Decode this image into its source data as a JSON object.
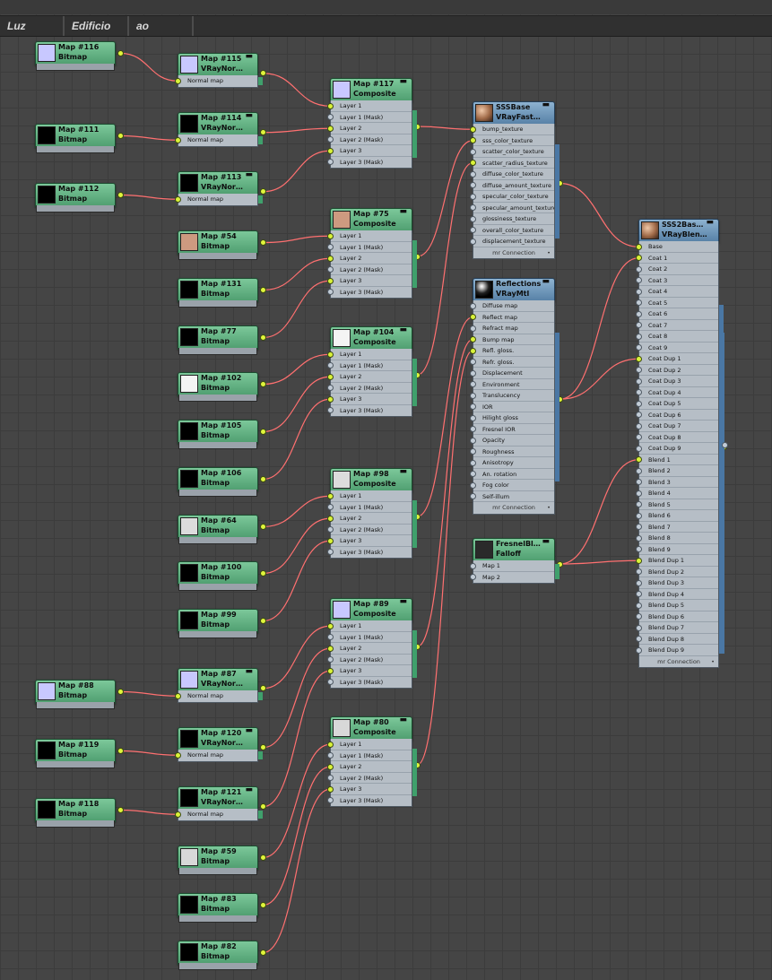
{
  "tabs": [
    {
      "label": "Luz"
    },
    {
      "label": "Edificio"
    },
    {
      "label": "ao"
    }
  ],
  "colors": {
    "wire": "#ff7070",
    "socket_on": "#d9f23a",
    "node_green": "#5ea57c",
    "node_blue": "#6d94b9"
  },
  "nodes": [
    {
      "id": "n116",
      "title": "Map #116",
      "type": "Bitmap",
      "thumb": "#c8c8ff"
    },
    {
      "id": "n111",
      "title": "Map #111",
      "type": "Bitmap",
      "thumb": "#000000"
    },
    {
      "id": "n112",
      "title": "Map #112",
      "type": "Bitmap",
      "thumb": "#000000"
    },
    {
      "id": "n88",
      "title": "Map #88",
      "type": "Bitmap",
      "thumb": "#c8c8ff"
    },
    {
      "id": "n119",
      "title": "Map #119",
      "type": "Bitmap",
      "thumb": "#000000"
    },
    {
      "id": "n118",
      "title": "Map #118",
      "type": "Bitmap",
      "thumb": "#000000"
    },
    {
      "id": "n115",
      "title": "Map #115",
      "type": "VRayNor…",
      "thumb": "#c8c8ff",
      "rows": [
        {
          "label": "Normal map",
          "on": true
        }
      ]
    },
    {
      "id": "n114",
      "title": "Map #114",
      "type": "VRayNor…",
      "thumb": "#000000",
      "rows": [
        {
          "label": "Normal map",
          "on": true
        }
      ]
    },
    {
      "id": "n113",
      "title": "Map #113",
      "type": "VRayNor…",
      "thumb": "#000000",
      "rows": [
        {
          "label": "Normal map",
          "on": true
        }
      ]
    },
    {
      "id": "n87",
      "title": "Map #87",
      "type": "VRayNor…",
      "thumb": "#c8c8ff",
      "rows": [
        {
          "label": "Normal map",
          "on": true
        }
      ]
    },
    {
      "id": "n120",
      "title": "Map #120",
      "type": "VRayNor…",
      "thumb": "#000000",
      "rows": [
        {
          "label": "Normal map",
          "on": true
        }
      ]
    },
    {
      "id": "n121",
      "title": "Map #121",
      "type": "VRayNor…",
      "thumb": "#000000",
      "rows": [
        {
          "label": "Normal map",
          "on": true
        }
      ]
    },
    {
      "id": "n54",
      "title": "Map #54",
      "type": "Bitmap",
      "thumb": "#cd9a80"
    },
    {
      "id": "n131",
      "title": "Map #131",
      "type": "Bitmap",
      "thumb": "#000000"
    },
    {
      "id": "n77",
      "title": "Map #77",
      "type": "Bitmap",
      "thumb": "#000000"
    },
    {
      "id": "n102",
      "title": "Map #102",
      "type": "Bitmap",
      "thumb": "#f4f4f4"
    },
    {
      "id": "n105",
      "title": "Map #105",
      "type": "Bitmap",
      "thumb": "#000000"
    },
    {
      "id": "n106",
      "title": "Map #106",
      "type": "Bitmap",
      "thumb": "#000000"
    },
    {
      "id": "n64",
      "title": "Map #64",
      "type": "Bitmap",
      "thumb": "#dcdcdc"
    },
    {
      "id": "n100",
      "title": "Map #100",
      "type": "Bitmap",
      "thumb": "#000000"
    },
    {
      "id": "n99",
      "title": "Map #99",
      "type": "Bitmap",
      "thumb": "#000000"
    },
    {
      "id": "n59",
      "title": "Map #59",
      "type": "Bitmap",
      "thumb": "#d8d8d8"
    },
    {
      "id": "n83",
      "title": "Map #83",
      "type": "Bitmap",
      "thumb": "#000000"
    },
    {
      "id": "n82",
      "title": "Map #82",
      "type": "Bitmap",
      "thumb": "#000000"
    },
    {
      "id": "n117",
      "title": "Map #117",
      "type": "Composite",
      "thumb": "#c8c8ff",
      "rows": [
        {
          "label": "Layer 1",
          "on": true
        },
        {
          "label": "Layer 1 (Mask)",
          "on": false
        },
        {
          "label": "Layer 2",
          "on": true
        },
        {
          "label": "Layer 2 (Mask)",
          "on": false
        },
        {
          "label": "Layer 3",
          "on": true
        },
        {
          "label": "Layer 3 (Mask)",
          "on": false
        }
      ]
    },
    {
      "id": "n75",
      "title": "Map #75",
      "type": "Composite",
      "thumb": "#cd9a80",
      "rows": [
        {
          "label": "Layer 1",
          "on": true
        },
        {
          "label": "Layer 1 (Mask)",
          "on": false
        },
        {
          "label": "Layer 2",
          "on": true
        },
        {
          "label": "Layer 2 (Mask)",
          "on": false
        },
        {
          "label": "Layer 3",
          "on": true
        },
        {
          "label": "Layer 3 (Mask)",
          "on": false
        }
      ]
    },
    {
      "id": "n104",
      "title": "Map #104",
      "type": "Composite",
      "thumb": "#f4f4f4",
      "rows": [
        {
          "label": "Layer 1",
          "on": true
        },
        {
          "label": "Layer 1 (Mask)",
          "on": false
        },
        {
          "label": "Layer 2",
          "on": true
        },
        {
          "label": "Layer 2 (Mask)",
          "on": false
        },
        {
          "label": "Layer 3",
          "on": true
        },
        {
          "label": "Layer 3 (Mask)",
          "on": false
        }
      ]
    },
    {
      "id": "n98",
      "title": "Map #98",
      "type": "Composite",
      "thumb": "#dcdcdc",
      "rows": [
        {
          "label": "Layer 1",
          "on": true
        },
        {
          "label": "Layer 1 (Mask)",
          "on": false
        },
        {
          "label": "Layer 2",
          "on": true
        },
        {
          "label": "Layer 2 (Mask)",
          "on": false
        },
        {
          "label": "Layer 3",
          "on": true
        },
        {
          "label": "Layer 3 (Mask)",
          "on": false
        }
      ]
    },
    {
      "id": "n89",
      "title": "Map #89",
      "type": "Composite",
      "thumb": "#c8c8ff",
      "rows": [
        {
          "label": "Layer 1",
          "on": true
        },
        {
          "label": "Layer 1 (Mask)",
          "on": false
        },
        {
          "label": "Layer 2",
          "on": true
        },
        {
          "label": "Layer 2 (Mask)",
          "on": false
        },
        {
          "label": "Layer 3",
          "on": true
        },
        {
          "label": "Layer 3 (Mask)",
          "on": false
        }
      ]
    },
    {
      "id": "n80",
      "title": "Map #80",
      "type": "Composite",
      "thumb": "#d8d8d8",
      "rows": [
        {
          "label": "Layer 1",
          "on": true
        },
        {
          "label": "Layer 1 (Mask)",
          "on": false
        },
        {
          "label": "Layer 2",
          "on": true
        },
        {
          "label": "Layer 2 (Mask)",
          "on": false
        },
        {
          "label": "Layer 3",
          "on": true
        },
        {
          "label": "Layer 3 (Mask)",
          "on": false
        }
      ]
    },
    {
      "id": "sss",
      "title": "SSSBase",
      "type": "VRayFast…",
      "thumb": "sphere-skin",
      "rows": [
        {
          "label": "bump_texture",
          "on": true
        },
        {
          "label": "sss_color_texture",
          "on": true
        },
        {
          "label": "scatter_color_texture",
          "on": false
        },
        {
          "label": "scatter_radius_texture",
          "on": true
        },
        {
          "label": "diffuse_color_texture",
          "on": false
        },
        {
          "label": "diffuse_amount_texture",
          "on": false
        },
        {
          "label": "specular_color_texture",
          "on": false
        },
        {
          "label": "specular_amount_texture",
          "on": false
        },
        {
          "label": "glossiness_texture",
          "on": false
        },
        {
          "label": "overall_color_texture",
          "on": false
        },
        {
          "label": "displacement_texture",
          "on": false
        },
        {
          "label": "mr Connection",
          "mr": true
        }
      ]
    },
    {
      "id": "refl",
      "title": "Reflections",
      "type": "VRayMtl",
      "thumb": "sphere-dark",
      "rows": [
        {
          "label": "Diffuse map",
          "on": false
        },
        {
          "label": "Reflect map",
          "on": true
        },
        {
          "label": "Refract map",
          "on": false
        },
        {
          "label": "Bump map",
          "on": true
        },
        {
          "label": "Refl. gloss.",
          "on": true
        },
        {
          "label": "Refr. gloss.",
          "on": false
        },
        {
          "label": "Displacement",
          "on": false
        },
        {
          "label": "Environment",
          "on": false
        },
        {
          "label": "Translucency",
          "on": false
        },
        {
          "label": "IOR",
          "on": false
        },
        {
          "label": "Hilight gloss",
          "on": false
        },
        {
          "label": "Fresnel IOR",
          "on": false
        },
        {
          "label": "Opacity",
          "on": false
        },
        {
          "label": "Roughness",
          "on": false
        },
        {
          "label": "Anisotropy",
          "on": false
        },
        {
          "label": "An. rotation",
          "on": false
        },
        {
          "label": "Fog color",
          "on": false
        },
        {
          "label": "Self-illum",
          "on": false
        },
        {
          "label": "mr Connection",
          "mr": true
        }
      ]
    },
    {
      "id": "fresnel",
      "title": "FresnelBl…",
      "type": "Falloff",
      "thumb": "#2a2a2a",
      "rows": [
        {
          "label": "Map 1",
          "on": false
        },
        {
          "label": "Map 2",
          "on": false
        }
      ]
    },
    {
      "id": "blend",
      "title": "SSS2Bas…",
      "type": "VRayBlen…",
      "thumb": "sphere-skin",
      "rows": [
        {
          "label": "Base",
          "on": true
        },
        {
          "label": "Coat 1",
          "on": true
        },
        {
          "label": "Coat 2",
          "on": false
        },
        {
          "label": "Coat 3",
          "on": false
        },
        {
          "label": "Coat 4",
          "on": false
        },
        {
          "label": "Coat 5",
          "on": false
        },
        {
          "label": "Coat 6",
          "on": false
        },
        {
          "label": "Coat 7",
          "on": false
        },
        {
          "label": "Coat 8",
          "on": false
        },
        {
          "label": "Coat 9",
          "on": false
        },
        {
          "label": "Coat Dup 1",
          "on": true
        },
        {
          "label": "Coat Dup 2",
          "on": false
        },
        {
          "label": "Coat Dup 3",
          "on": false
        },
        {
          "label": "Coat Dup 4",
          "on": false
        },
        {
          "label": "Coat Dup 5",
          "on": false
        },
        {
          "label": "Coat Dup 6",
          "on": false
        },
        {
          "label": "Coat Dup 7",
          "on": false
        },
        {
          "label": "Coat Dup 8",
          "on": false
        },
        {
          "label": "Coat Dup 9",
          "on": false
        },
        {
          "label": "Blend 1",
          "on": true
        },
        {
          "label": "Blend 2",
          "on": false
        },
        {
          "label": "Blend 3",
          "on": false
        },
        {
          "label": "Blend 4",
          "on": false
        },
        {
          "label": "Blend 5",
          "on": false
        },
        {
          "label": "Blend 6",
          "on": false
        },
        {
          "label": "Blend 7",
          "on": false
        },
        {
          "label": "Blend 8",
          "on": false
        },
        {
          "label": "Blend 9",
          "on": false
        },
        {
          "label": "Blend Dup 1",
          "on": true
        },
        {
          "label": "Blend Dup 2",
          "on": false
        },
        {
          "label": "Blend Dup 3",
          "on": false
        },
        {
          "label": "Blend Dup 4",
          "on": false
        },
        {
          "label": "Blend Dup 5",
          "on": false
        },
        {
          "label": "Blend Dup 6",
          "on": false
        },
        {
          "label": "Blend Dup 7",
          "on": false
        },
        {
          "label": "Blend Dup 8",
          "on": false
        },
        {
          "label": "Blend Dup 9",
          "on": false
        },
        {
          "label": "mr Connection",
          "mr": true
        }
      ]
    }
  ],
  "connections": [
    {
      "from": "n116",
      "to": "n115",
      "slot": 0
    },
    {
      "from": "n111",
      "to": "n114",
      "slot": 0
    },
    {
      "from": "n112",
      "to": "n113",
      "slot": 0
    },
    {
      "from": "n88",
      "to": "n87",
      "slot": 0
    },
    {
      "from": "n119",
      "to": "n120",
      "slot": 0
    },
    {
      "from": "n118",
      "to": "n121",
      "slot": 0
    },
    {
      "from": "n115",
      "to": "n117",
      "slot": 0
    },
    {
      "from": "n114",
      "to": "n117",
      "slot": 2
    },
    {
      "from": "n113",
      "to": "n117",
      "slot": 4
    },
    {
      "from": "n54",
      "to": "n75",
      "slot": 0
    },
    {
      "from": "n131",
      "to": "n75",
      "slot": 2
    },
    {
      "from": "n77",
      "to": "n75",
      "slot": 4
    },
    {
      "from": "n102",
      "to": "n104",
      "slot": 0
    },
    {
      "from": "n105",
      "to": "n104",
      "slot": 2
    },
    {
      "from": "n106",
      "to": "n104",
      "slot": 4
    },
    {
      "from": "n64",
      "to": "n98",
      "slot": 0
    },
    {
      "from": "n100",
      "to": "n98",
      "slot": 2
    },
    {
      "from": "n99",
      "to": "n98",
      "slot": 4
    },
    {
      "from": "n87",
      "to": "n89",
      "slot": 0
    },
    {
      "from": "n120",
      "to": "n89",
      "slot": 2
    },
    {
      "from": "n121",
      "to": "n89",
      "slot": 4
    },
    {
      "from": "n59",
      "to": "n80",
      "slot": 0
    },
    {
      "from": "n83",
      "to": "n80",
      "slot": 2
    },
    {
      "from": "n82",
      "to": "n80",
      "slot": 4
    },
    {
      "from": "n117",
      "to": "sss",
      "slot": 0
    },
    {
      "from": "n75",
      "to": "sss",
      "slot": 1
    },
    {
      "from": "n104",
      "to": "sss",
      "slot": 3
    },
    {
      "from": "n98",
      "to": "refl",
      "slot": 1
    },
    {
      "from": "n89",
      "to": "refl",
      "slot": 3
    },
    {
      "from": "n80",
      "to": "refl",
      "slot": 4
    },
    {
      "from": "sss",
      "to": "blend",
      "slot": 0
    },
    {
      "from": "refl",
      "to": "blend",
      "slot": 1
    },
    {
      "from": "refl",
      "to": "blend",
      "slot": 10
    },
    {
      "from": "fresnel",
      "to": "blend",
      "slot": 19
    },
    {
      "from": "fresnel",
      "to": "blend",
      "slot": 28
    }
  ]
}
